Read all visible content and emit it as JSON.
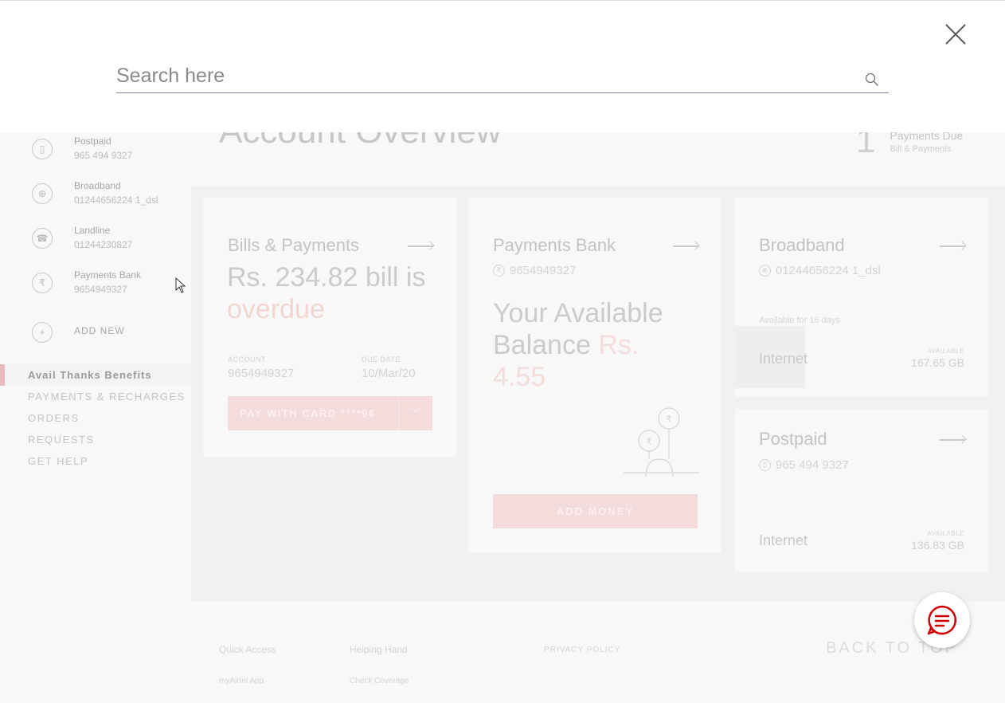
{
  "search": {
    "placeholder": "Search here",
    "value": ""
  },
  "accounts": [
    {
      "name": "Postpaid",
      "number": "965 494 9327",
      "icon": "sim-icon"
    },
    {
      "name": "Broadband",
      "number": "01244656224 1_dsl",
      "icon": "globe-icon"
    },
    {
      "name": "Landline",
      "number": "01244230827",
      "icon": "landline-icon"
    },
    {
      "name": "Payments Bank",
      "number": "9654949327",
      "icon": "rupee-icon"
    },
    {
      "name": "ADD NEW",
      "number": "",
      "icon": "plus-icon"
    }
  ],
  "side_nav": {
    "items": [
      {
        "label": "Avail Thanks Benefits"
      },
      {
        "label": "PAYMENTS & RECHARGES"
      },
      {
        "label": "ORDERS"
      },
      {
        "label": "REQUESTS"
      },
      {
        "label": "GET HELP"
      }
    ]
  },
  "main": {
    "title": "Account Overview",
    "payments_due": {
      "count": "1",
      "label": "Payments Due",
      "sub": "Bill & Payments"
    }
  },
  "bills_card": {
    "title": "Bills & Payments",
    "amount_text": "Rs. 234.82 bill is",
    "status": "overdue",
    "account_label": "ACCOUNT",
    "account": "9654949327",
    "due_label": "DUE DATE",
    "due": "10/Mar/20",
    "pay_button": "PAY WITH CARD ****96"
  },
  "bank_card": {
    "title": "Payments Bank",
    "number": "9654949327",
    "balance_text": "Your Available Balance",
    "balance_value": "Rs. 4.55",
    "add_money": "ADD MONEY"
  },
  "broadband_card": {
    "title": "Broadband",
    "number": "01244656224 1_dsl",
    "validity": "Available for 16 days",
    "usage_name": "Internet",
    "usage_label": "AVAILABLE",
    "usage_value": "167.65 GB"
  },
  "postpaid_card": {
    "title": "Postpaid",
    "number": "965 494 9327",
    "usage_name": "Internet",
    "usage_label": "AVAILABLE",
    "usage_value": "136.83 GB"
  },
  "footer": {
    "quick_access": "Quick Access",
    "helping_hand": "Helping Hand",
    "privacy": "PRIVACY POLICY",
    "myairtel": "myAirtel App",
    "check_coverage": "Check Coverage",
    "back_to_top": "BACK TO TOP"
  },
  "colors": {
    "accent": "#e40000",
    "overlay_text": "#8a8a8a"
  }
}
